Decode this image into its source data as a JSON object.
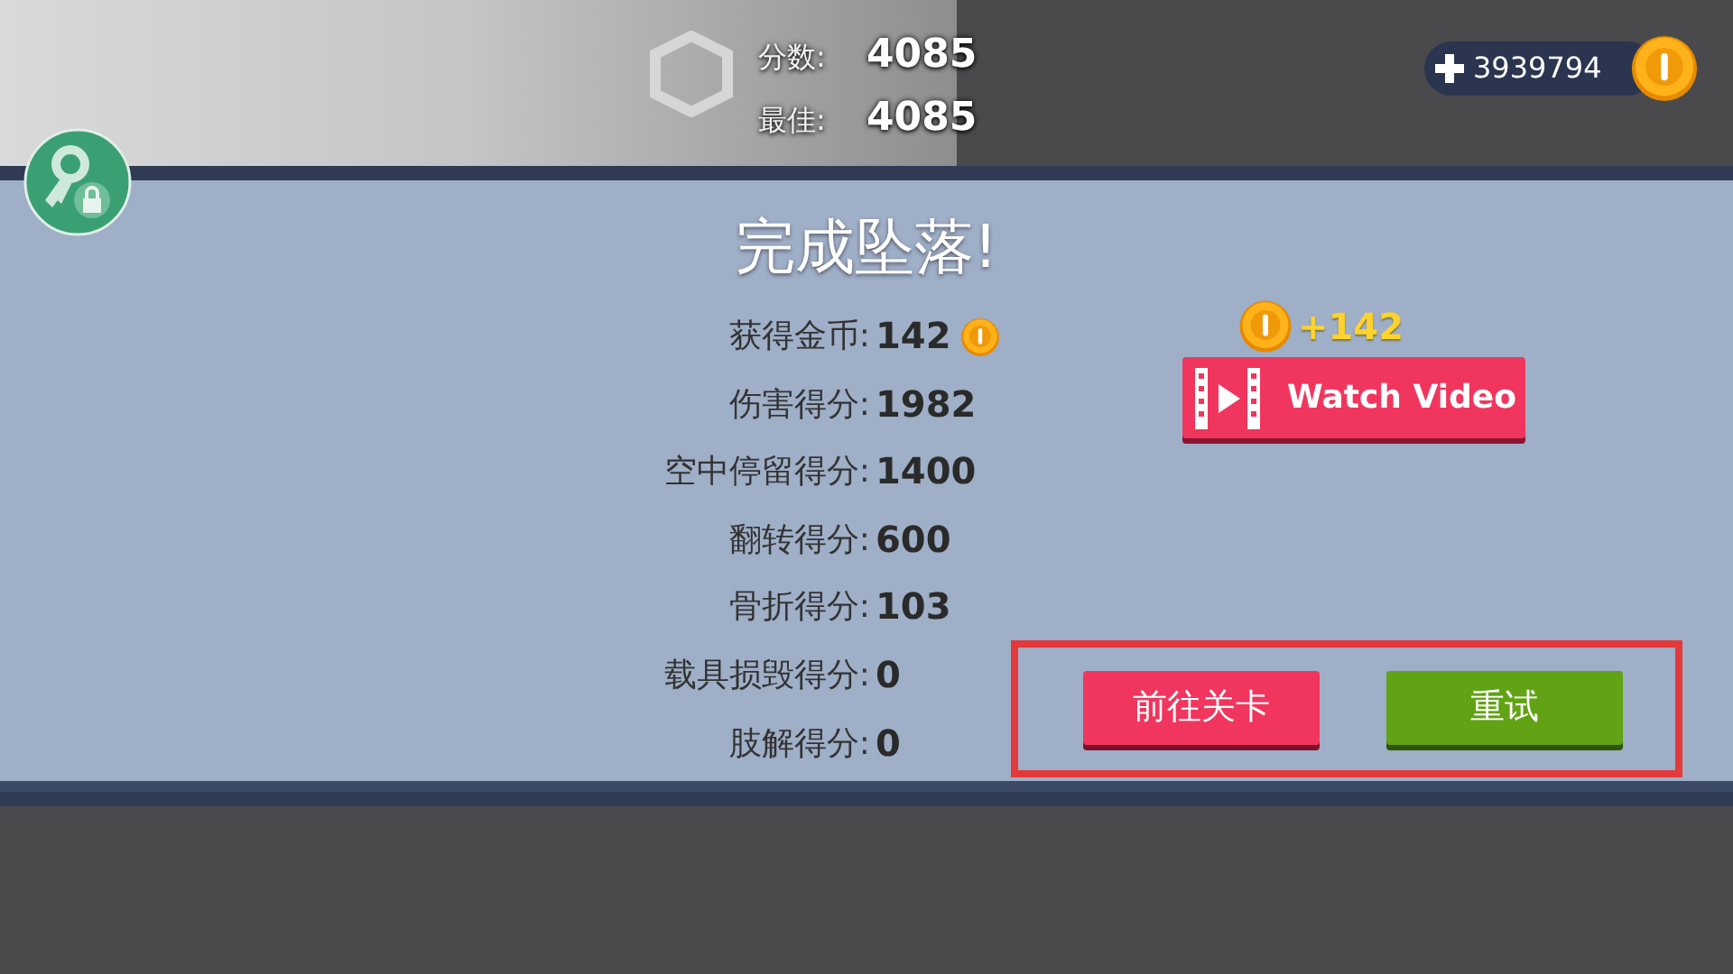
{
  "score": {
    "items": [
      {
        "label": "分数:",
        "value": "4085"
      },
      {
        "label": "最佳:",
        "value": "4085"
      }
    ]
  },
  "currency": {
    "amount": "3939794"
  },
  "title": "完成坠落!",
  "stats": [
    {
      "label": "获得金币:",
      "value": "142",
      "kind": "coins"
    },
    {
      "label": "伤害得分:",
      "value": "1982",
      "kind": "score"
    },
    {
      "label": "空中停留得分:",
      "value": "1400",
      "kind": "score"
    },
    {
      "label": "翻转得分:",
      "value": "600",
      "kind": "score"
    },
    {
      "label": "骨折得分:",
      "value": "103",
      "kind": "score"
    },
    {
      "label": "载具损毁得分:",
      "value": "0",
      "kind": "score"
    },
    {
      "label": "肢解得分:",
      "value": "0",
      "kind": "score"
    }
  ],
  "reward": {
    "amount": "+142",
    "button": "Watch Video"
  },
  "actions": [
    {
      "label": "前往关卡",
      "kind": "red"
    },
    {
      "label": "重试",
      "kind": "green"
    }
  ]
}
